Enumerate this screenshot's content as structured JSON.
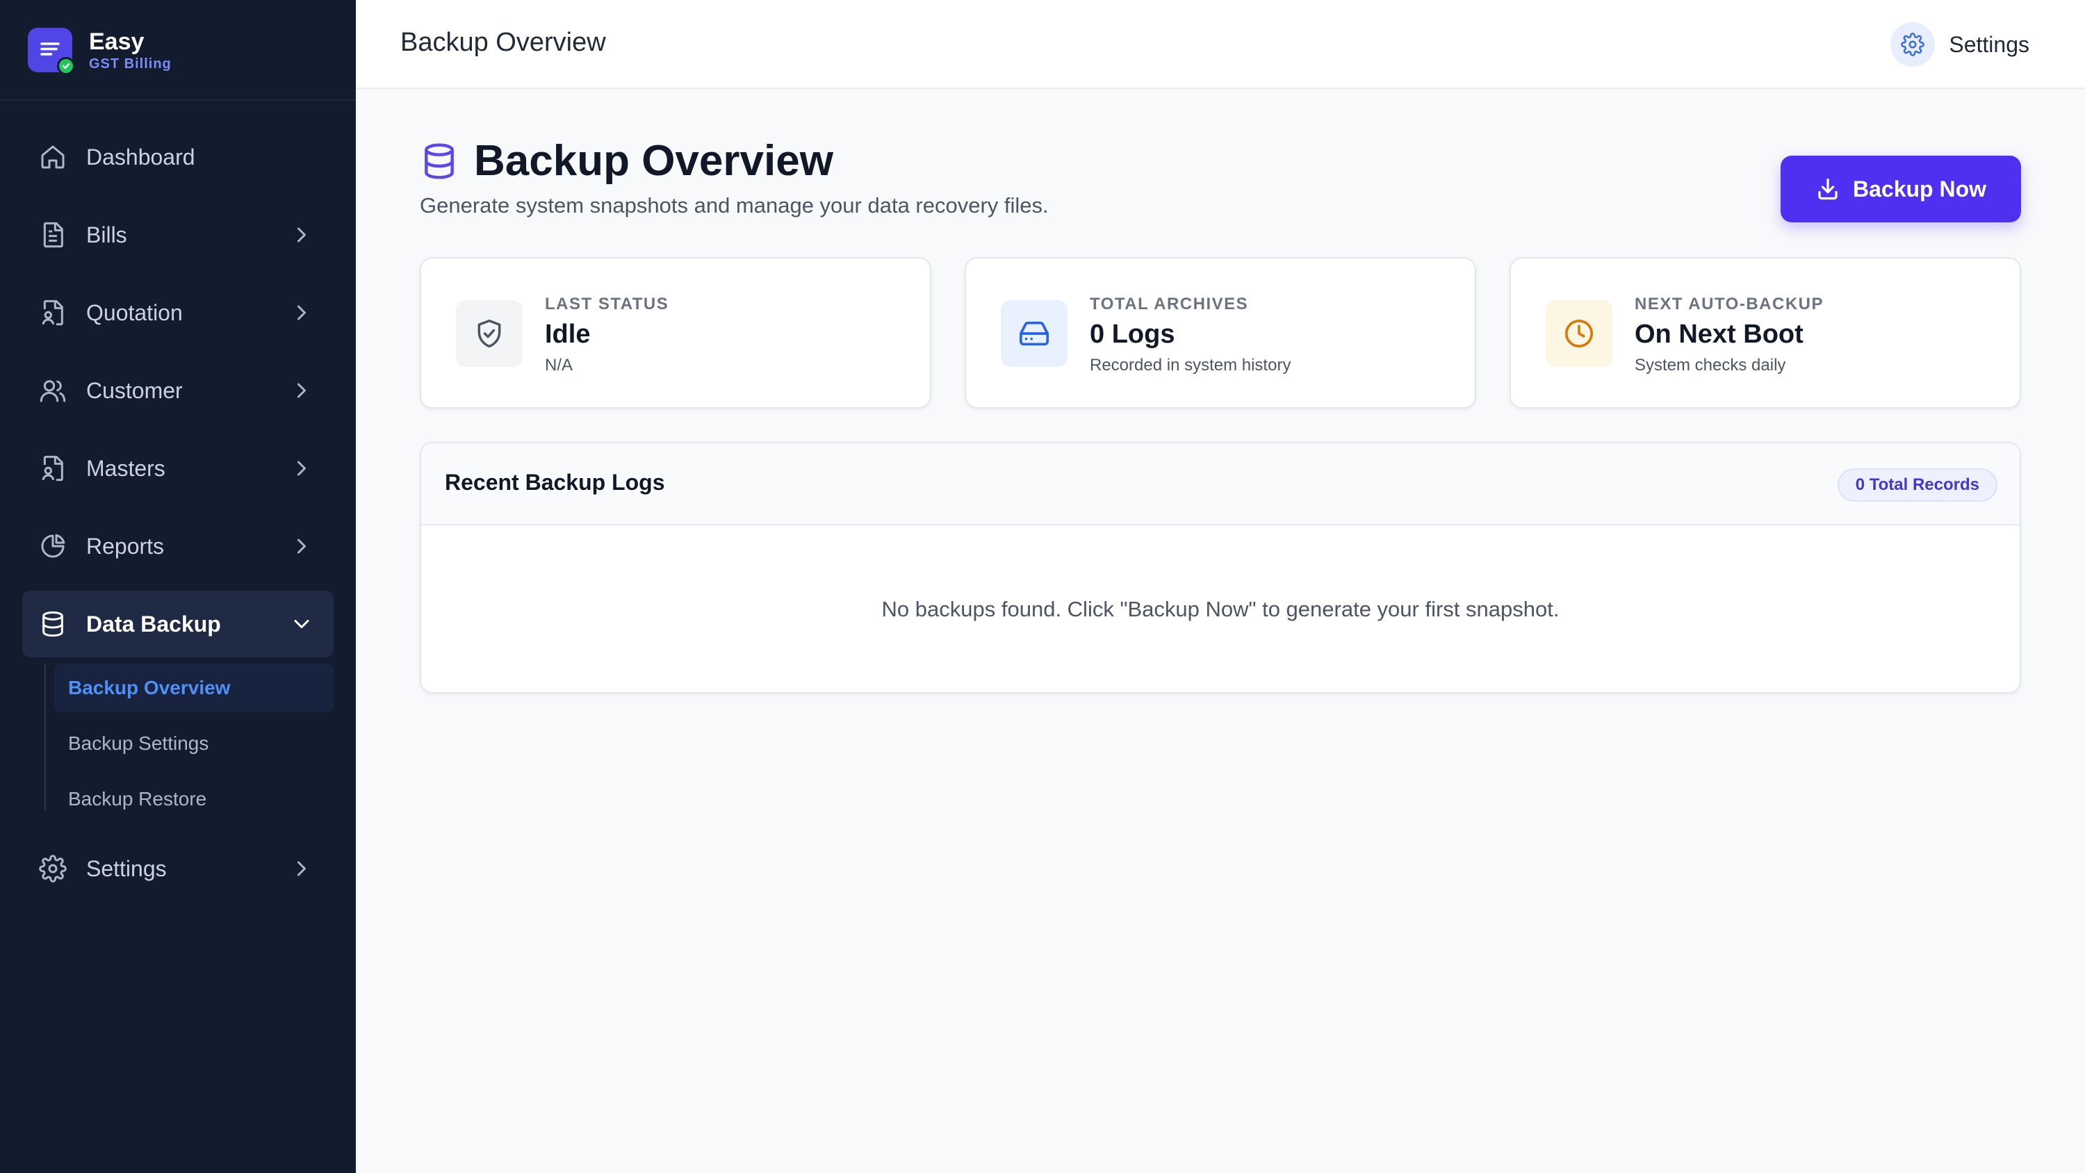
{
  "brand": {
    "name": "Easy",
    "subtitle": "GST Billing"
  },
  "sidebar": {
    "items": [
      {
        "label": "Dashboard",
        "icon": "home-icon"
      },
      {
        "label": "Bills",
        "icon": "document-icon"
      },
      {
        "label": "Quotation",
        "icon": "file-person-icon"
      },
      {
        "label": "Customer",
        "icon": "users-icon"
      },
      {
        "label": "Masters",
        "icon": "file-person-icon"
      },
      {
        "label": "Reports",
        "icon": "pie-chart-icon"
      },
      {
        "label": "Data Backup",
        "icon": "database-icon",
        "active": true,
        "expanded": true
      },
      {
        "label": "Settings",
        "icon": "gear-icon"
      }
    ],
    "subitems": [
      {
        "label": "Backup Overview",
        "active": true
      },
      {
        "label": "Backup Settings"
      },
      {
        "label": "Backup Restore"
      }
    ]
  },
  "header": {
    "title": "Backup Overview",
    "settings_label": "Settings"
  },
  "main": {
    "title": "Backup Overview",
    "subtitle": "Generate system snapshots and manage your data recovery files.",
    "backup_button": "Backup Now",
    "cards": [
      {
        "label": "LAST STATUS",
        "value": "Idle",
        "note": "N/A",
        "icon": "shield-check-icon",
        "icon_color": "#4b5563",
        "icon_bg": "#f3f4f6"
      },
      {
        "label": "TOTAL ARCHIVES",
        "value": "0 Logs",
        "note": "Recorded in system history",
        "icon": "hard-drive-icon",
        "icon_color": "#2563eb",
        "icon_bg": "#eaf1fe"
      },
      {
        "label": "NEXT AUTO-BACKUP",
        "value": "On Next Boot",
        "note": "System checks daily",
        "icon": "clock-icon",
        "icon_color": "#d97706",
        "icon_bg": "#fdf6e3"
      }
    ],
    "logs": {
      "title": "Recent Backup Logs",
      "badge": "0 Total Records",
      "empty_message": "No backups found. Click \"Backup Now\" to generate your first snapshot."
    }
  },
  "colors": {
    "sidebar_bg": "#131b2e",
    "accent": "#4f2ff0",
    "active_sub": "#4f8ff7"
  }
}
